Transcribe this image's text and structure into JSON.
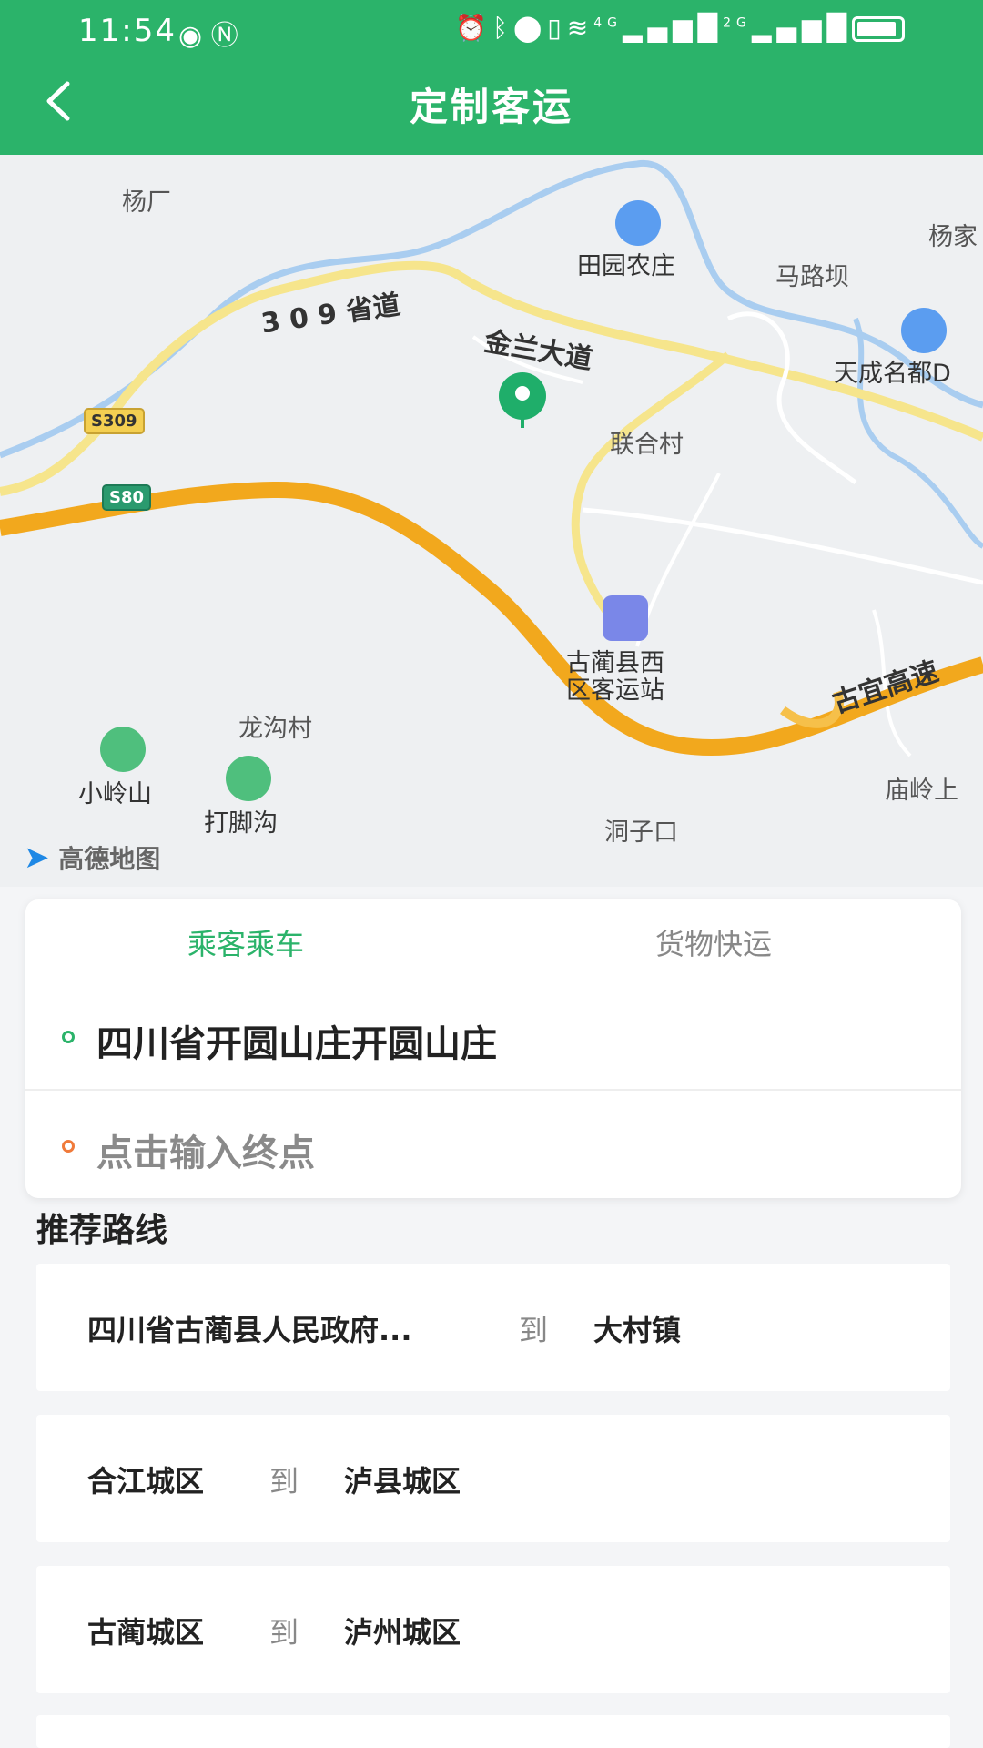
{
  "status_bar": {
    "time": "11:54",
    "left_icons": [
      "eye-icon",
      "nfc-icon"
    ],
    "right_icons": [
      "alarm-icon",
      "bluetooth-icon",
      "location-icon",
      "vibrate-icon",
      "wifi-icon",
      "signal-4g-icon",
      "signal-2g-icon",
      "battery-icon"
    ],
    "net1": "4G",
    "net2": "2G"
  },
  "header": {
    "title": "定制客运",
    "back_icon": "chevron-left-icon"
  },
  "colors": {
    "brand": "#2bb36a",
    "start_dot": "#2bb36a",
    "end_dot": "#f07a3a"
  },
  "map": {
    "labels": {
      "yangchang": "杨厂",
      "tianyuan": "田园农庄",
      "yangjia": "杨家",
      "malu": "马路坝",
      "tiancheng": "天成名都D",
      "lianhe": "联合村",
      "station_line1": "古蔺县西",
      "station_line2": "区客运站",
      "longgou": "龙沟村",
      "xiaoling": "小岭山",
      "dajiao": "打脚沟",
      "dongzi": "洞子口",
      "miaoling": "庙岭上"
    },
    "roads": {
      "s309_name": "3 0 9 省道",
      "jinlan": "金兰大道",
      "guyi": "古宜高速"
    },
    "shields": {
      "s309": "S309",
      "s80": "S80"
    },
    "logo": "高德地图"
  },
  "tabs": {
    "passenger": "乘客乘车",
    "cargo": "货物快运",
    "active": "passenger"
  },
  "locations": {
    "start": "四川省开圆山庄开圆山庄",
    "end_placeholder": "点击输入终点"
  },
  "recommended": {
    "title": "推荐路线",
    "connector": "到",
    "routes": [
      {
        "from": "四川省古蔺县人民政府...",
        "to": "大村镇"
      },
      {
        "from": "合江城区",
        "to": "泸县城区"
      },
      {
        "from": "古蔺城区",
        "to": "泸州城区"
      }
    ]
  }
}
